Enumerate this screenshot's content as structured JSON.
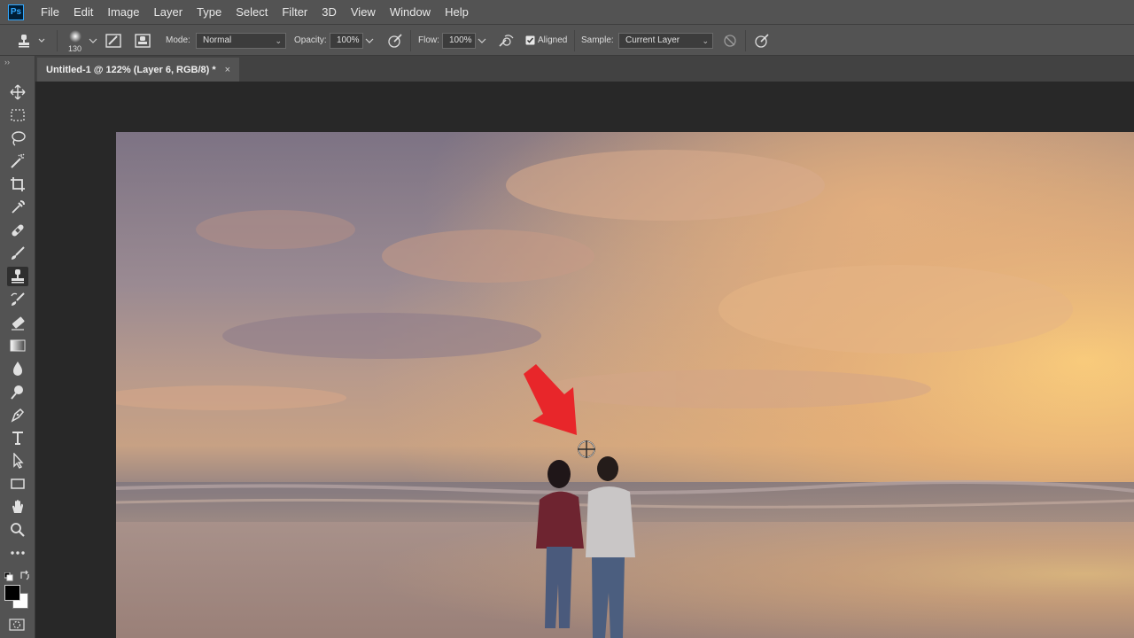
{
  "app": {
    "logo_text": "Ps"
  },
  "menu": [
    "File",
    "Edit",
    "Image",
    "Layer",
    "Type",
    "Select",
    "Filter",
    "3D",
    "View",
    "Window",
    "Help"
  ],
  "options": {
    "brush_size": "130",
    "mode_label": "Mode:",
    "mode_value": "Normal",
    "opacity_label": "Opacity:",
    "opacity_value": "100%",
    "flow_label": "Flow:",
    "flow_value": "100%",
    "aligned_label": "Aligned",
    "aligned_checked": true,
    "sample_label": "Sample:",
    "sample_value": "Current Layer"
  },
  "document": {
    "tab_title": "Untitled-1 @ 122% (Layer 6, RGB/8) *",
    "close_glyph": "×"
  },
  "toolbar": {
    "grip": "››",
    "active_tool": "clone-stamp",
    "tools": [
      "move",
      "marquee",
      "lasso",
      "magic-wand",
      "crop",
      "eyedropper",
      "healing-brush",
      "brush",
      "clone-stamp",
      "history-brush",
      "eraser",
      "gradient",
      "blur",
      "dodge",
      "pen",
      "type",
      "path-selection",
      "rectangle",
      "hand",
      "zoom",
      "more"
    ]
  },
  "colors": {
    "accent": "#31a8ff",
    "annotation_arrow": "#e8262a",
    "foreground_swatch": "#000000",
    "background_swatch": "#ffffff"
  }
}
